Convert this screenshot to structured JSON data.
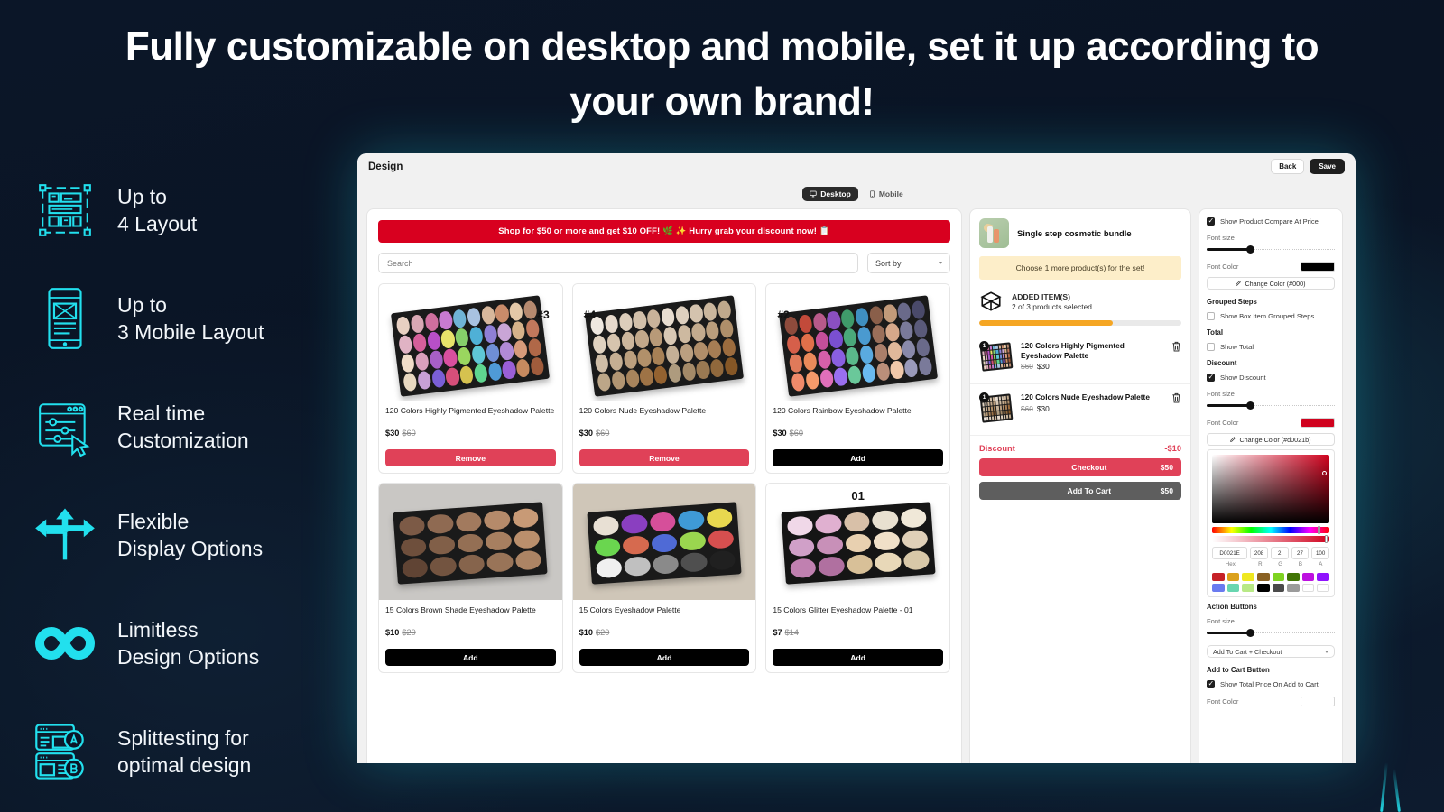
{
  "headline": "Fully customizable on desktop and mobile, set it up according to your own brand!",
  "features": [
    {
      "icon": "layout-frame-icon",
      "label": "Up to\n4 Layout"
    },
    {
      "icon": "mobile-wireframe-icon",
      "label": "Up to\n3 Mobile Layout"
    },
    {
      "icon": "sliders-cursor-icon",
      "label": "Real time\nCustomization"
    },
    {
      "icon": "arrows-branch-icon",
      "label": "Flexible\nDisplay Options"
    },
    {
      "icon": "infinity-icon",
      "label": "Limitless\nDesign Options"
    },
    {
      "icon": "split-test-ab-icon",
      "label": "Splittesting for\noptimal design"
    }
  ],
  "app": {
    "title": "Design",
    "back_label": "Back",
    "save_label": "Save",
    "device_tabs": [
      {
        "label": "Desktop",
        "icon": "desktop-icon",
        "active": true
      },
      {
        "label": "Mobile",
        "icon": "mobile-icon",
        "active": false
      }
    ]
  },
  "storefront": {
    "promo_banner": "Shop for $50 or more and get $10 OFF! 🌿 ✨ Hurry grab your discount now! 📋",
    "search_placeholder": "Search",
    "sort_label": "Sort by",
    "products": [
      {
        "rank": "#3",
        "title": "120 Colors Highly Pigmented Eyeshadow Palette",
        "price": "$30",
        "compare_at": "$60",
        "button": "Remove",
        "button_style": "remove"
      },
      {
        "rank": "#4",
        "title": "120 Colors Nude Eyeshadow Palette",
        "price": "$30",
        "compare_at": "$60",
        "button": "Remove",
        "button_style": "remove"
      },
      {
        "rank": "#2",
        "title": "120 Colors Rainbow Eyeshadow Palette",
        "price": "$30",
        "compare_at": "$60",
        "button": "Add",
        "button_style": "add"
      },
      {
        "rank": "",
        "title": "15 Colors Brown Shade Eyeshadow Palette",
        "price": "$10",
        "compare_at": "$20",
        "button": "Add",
        "button_style": "add"
      },
      {
        "rank": "",
        "title": "15 Colors Eyeshadow Palette",
        "price": "$10",
        "compare_at": "$20",
        "button": "Add",
        "button_style": "add"
      },
      {
        "rank": "01",
        "title": "15 Colors Glitter Eyeshadow Palette - 01",
        "price": "$7",
        "compare_at": "$14",
        "button": "Add",
        "button_style": "add"
      }
    ]
  },
  "cart": {
    "bundle_title": "Single step cosmetic bundle",
    "note": "Choose 1 more product(s) for the set!",
    "added_label": "ADDED ITEM(S)",
    "added_count": "2 of 3 products selected",
    "progress_percent": 66,
    "items": [
      {
        "qty": "1",
        "name": "120 Colors Highly Pigmented Eyeshadow Palette",
        "compare_at": "$60",
        "price": "$30"
      },
      {
        "qty": "1",
        "name": "120 Colors Nude Eyeshadow Palette",
        "compare_at": "$60",
        "price": "$30"
      }
    ],
    "discount_label": "Discount",
    "discount_value": "-$10",
    "checkout_label": "Checkout",
    "checkout_total": "$50",
    "addtocart_label": "Add To Cart",
    "addtocart_total": "$50"
  },
  "settings": {
    "compare_at_checkbox": "Show Product Compare At Price",
    "font_size_label": "Font size",
    "font_color_label": "Font Color",
    "change_color_black": "Change Color (#000)",
    "grouped_steps_head": "Grouped Steps",
    "grouped_steps_checkbox": "Show Box Item Grouped Steps",
    "total_head": "Total",
    "total_checkbox": "Show Total",
    "discount_head": "Discount",
    "discount_checkbox": "Show Discount",
    "change_color_red": "Change Color (#d0021b)",
    "picker": {
      "hex": "D0021E",
      "r": "208",
      "g": "2",
      "b": "27",
      "a": "100",
      "hex_label": "Hex",
      "r_label": "R",
      "g_label": "G",
      "b_label": "B",
      "a_label": "A",
      "swatches": [
        "#c62127",
        "#dba11c",
        "#efe820",
        "#8a6123",
        "#7ed321",
        "#417505",
        "#bd10e0",
        "#9013fe",
        "#6a7bf0",
        "#68d6b0",
        "#b8e986",
        "#000000",
        "#4a4a4a",
        "#9b9b9b",
        "#ffffff",
        "#ffffff"
      ]
    },
    "action_buttons_head": "Action Buttons",
    "action_buttons_select": "Add To Cart + Checkout",
    "add_to_cart_head": "Add to Cart Button",
    "add_to_cart_checkbox": "Show Total Price On Add to Cart",
    "bottom_font_color_label": "Font Color"
  },
  "colors": {
    "accent": "#22e0ee",
    "promo_red": "#d8001f",
    "cta_red": "#e04158",
    "picker_red": "#d0021e",
    "progress_orange": "#f5a623"
  }
}
